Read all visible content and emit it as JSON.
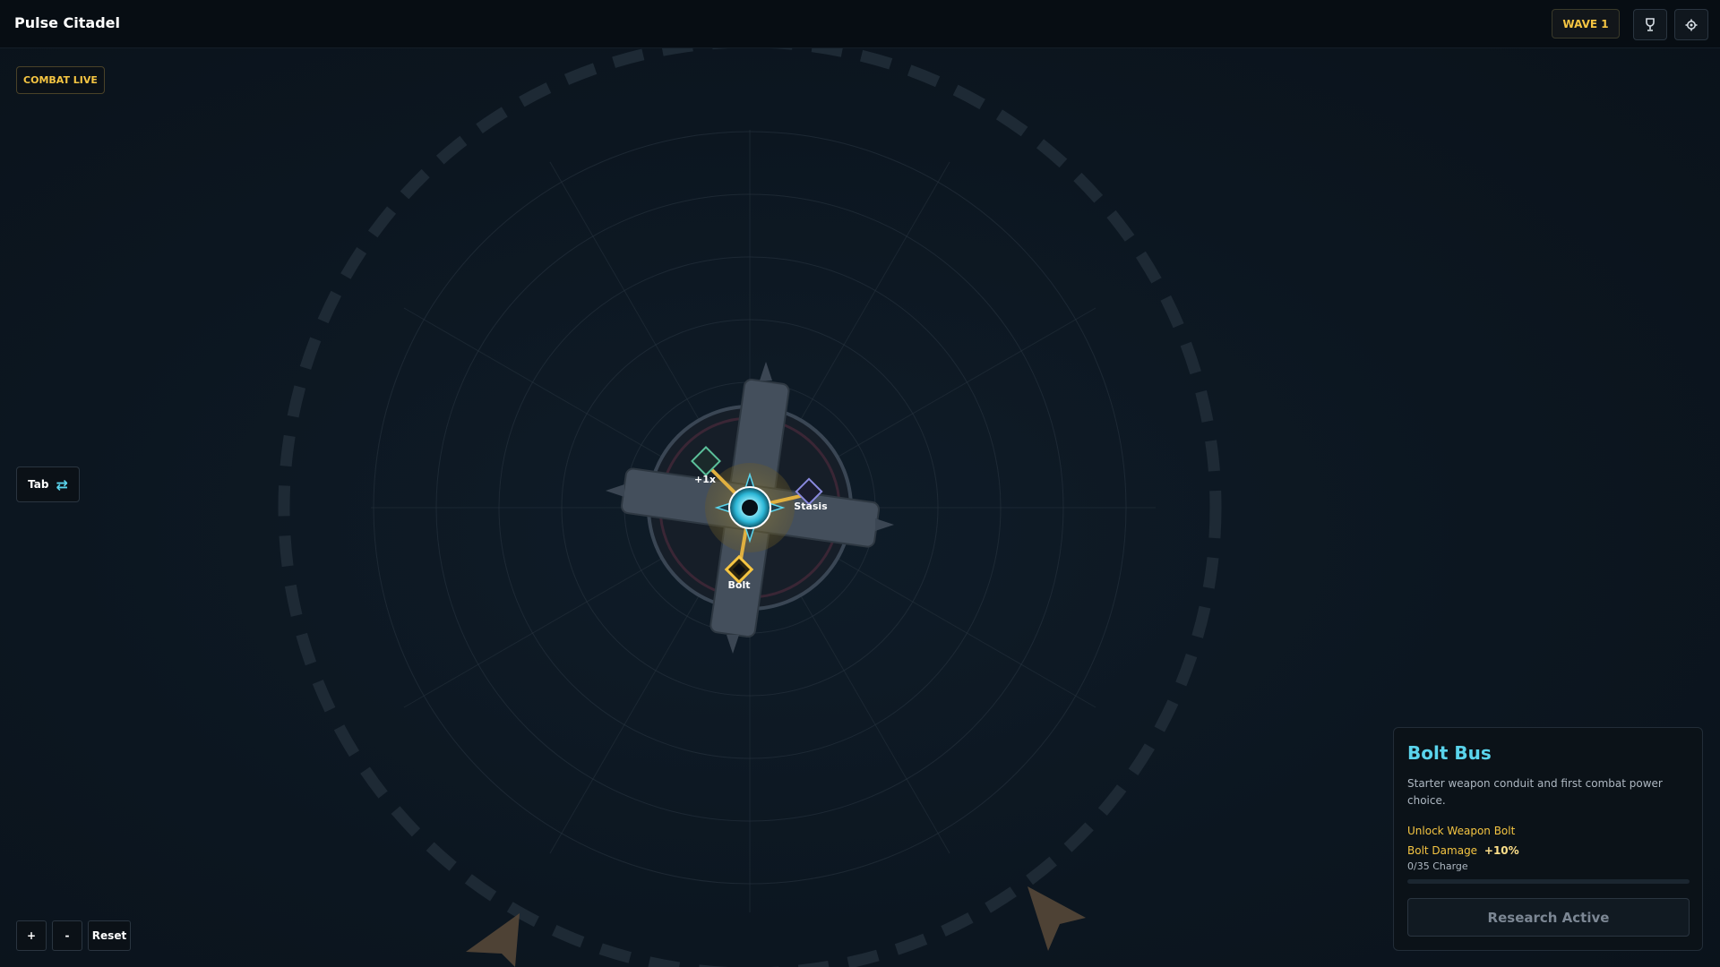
{
  "app": {
    "title": "Pulse Citadel"
  },
  "header": {
    "wave_label": "WAVE 1"
  },
  "status": {
    "combat_label": "COMBAT LIVE"
  },
  "controls": {
    "tab_label": "Tab",
    "zoom_in_label": "+",
    "zoom_out_label": "-",
    "reset_label": "Reset"
  },
  "map": {
    "nodes": [
      {
        "id": "multiplier",
        "label": "+1x",
        "color": "#5bbf9a"
      },
      {
        "id": "stasis",
        "label": "Stasis",
        "color": "#8a8adf"
      },
      {
        "id": "bolt",
        "label": "Bolt",
        "color": "#f5c542"
      }
    ]
  },
  "panel": {
    "title": "Bolt Bus",
    "description": "Starter weapon conduit and first combat power choice.",
    "effects": [
      {
        "text": "Unlock Weapon Bolt",
        "highlight": ""
      },
      {
        "text": "Bolt Damage",
        "highlight": "+10%"
      }
    ],
    "charge_text": "0/35 Charge",
    "charge_fraction": 0,
    "action_label": "Research Active"
  },
  "colors": {
    "accent_cyan": "#5ad4ec",
    "accent_gold": "#f5c542",
    "background": "#0d1620"
  },
  "icons": {
    "trophy": "trophy-icon",
    "settings": "gear-icon",
    "swap": "swap-icon"
  }
}
